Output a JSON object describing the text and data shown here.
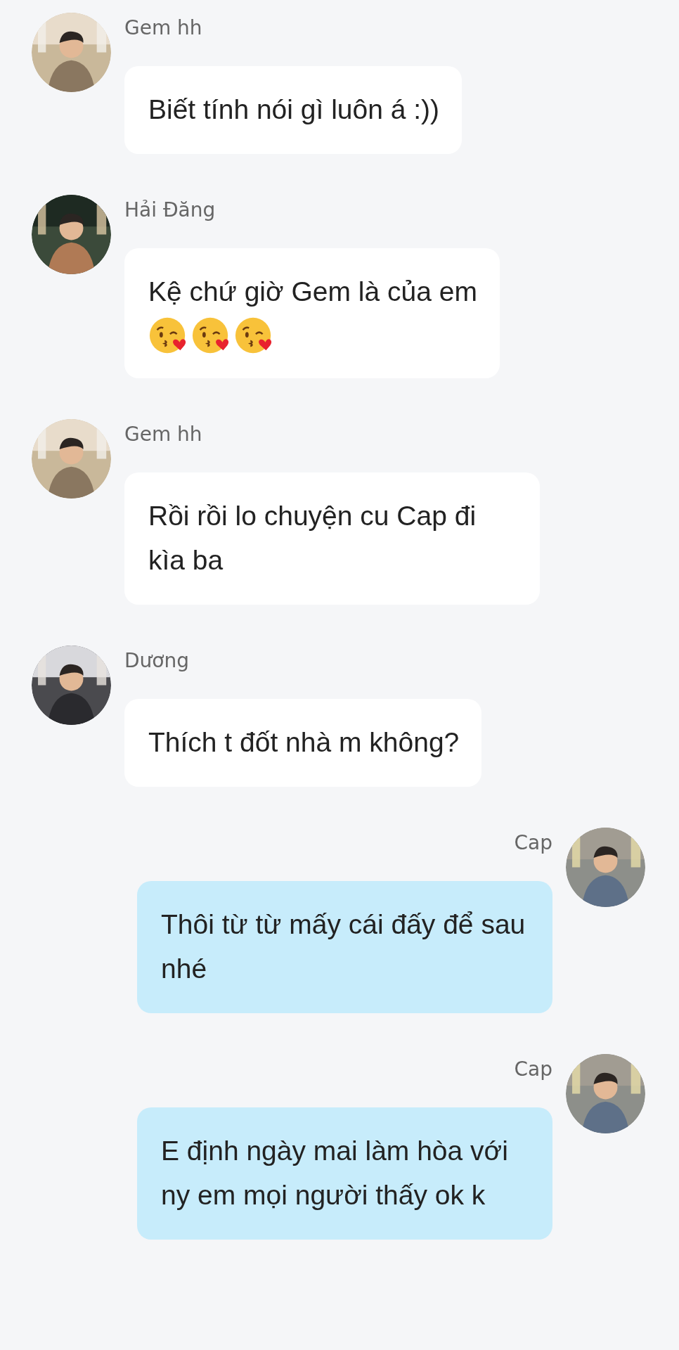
{
  "messages": [
    {
      "sender": "Gem hh",
      "kind": "incoming",
      "text": "Biết tính nói gì luôn á :))"
    },
    {
      "sender": "Hải Đăng",
      "kind": "incoming",
      "text": "Kệ chứ giờ Gem là của em",
      "emojis": [
        {
          "kind": "kiss"
        },
        {
          "kind": "kiss"
        },
        {
          "kind": "kiss"
        }
      ]
    },
    {
      "sender": "Gem hh",
      "kind": "incoming",
      "text": "Rồi rồi lo chuyện cu Cap đi kìa ba"
    },
    {
      "sender": "Dương",
      "kind": "incoming",
      "text": "Thích t đốt nhà m không?"
    },
    {
      "sender": "Cap",
      "kind": "outgoing",
      "text": "Thôi từ từ mấy cái đấy để sau nhé"
    },
    {
      "sender": "Cap",
      "kind": "outgoing",
      "text": "E định ngày mai làm hòa với ny em mọi người thấy ok k"
    }
  ]
}
